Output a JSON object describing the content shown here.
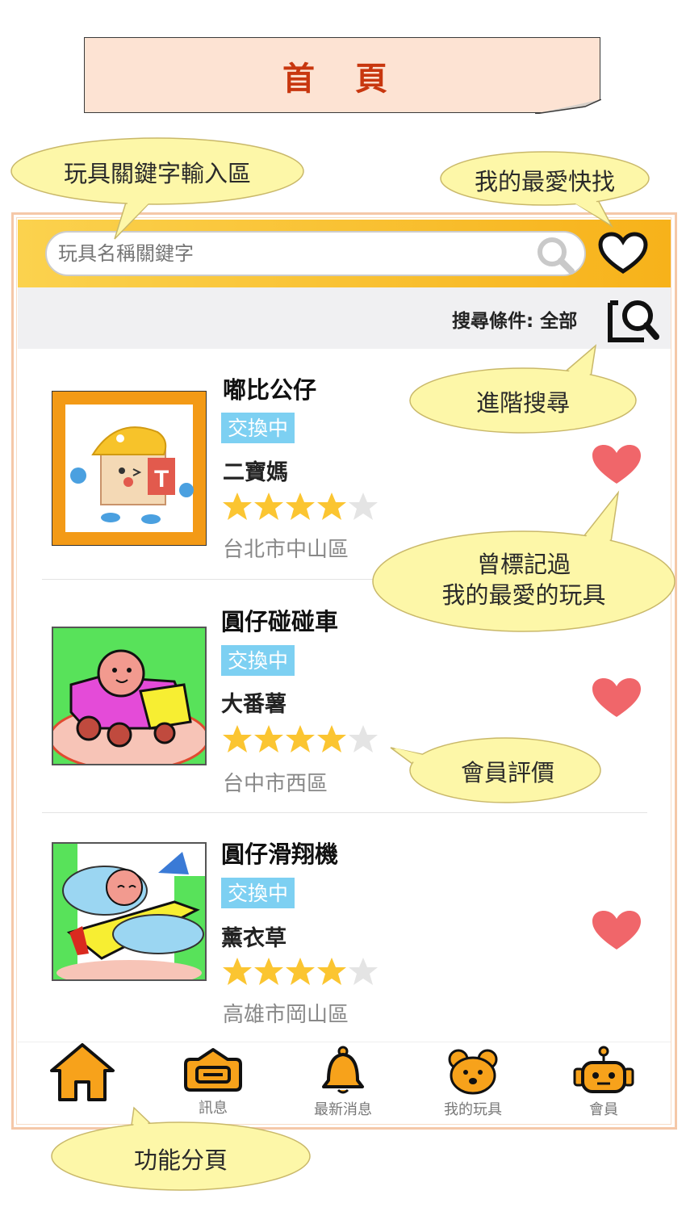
{
  "page_title": "首 頁",
  "search": {
    "placeholder": "玩具名稱關鍵字",
    "filter_label": "搜尋條件: 全部"
  },
  "items": [
    {
      "name": "嘟比公仔",
      "status": "交換中",
      "owner": "二寶媽",
      "rating": 4,
      "location": "台北市中山區",
      "favorited": true
    },
    {
      "name": "圓仔碰碰車",
      "status": "交換中",
      "owner": "大番薯",
      "rating": 4,
      "location": "台中市西區",
      "favorited": true
    },
    {
      "name": "圓仔滑翔機",
      "status": "交換中",
      "owner": "薰衣草",
      "rating": 4,
      "location": "高雄市岡山區",
      "favorited": true
    }
  ],
  "nav": [
    {
      "label": "",
      "icon": "home-icon"
    },
    {
      "label": "訊息",
      "icon": "message-icon"
    },
    {
      "label": "最新消息",
      "icon": "bell-icon"
    },
    {
      "label": "我的玩具",
      "icon": "bear-icon"
    },
    {
      "label": "會員",
      "icon": "robot-icon"
    }
  ],
  "callouts": {
    "keyword": "玩具關鍵字輸入區",
    "favorites": "我的最愛快找",
    "advanced": "進階搜尋",
    "marked_line1": "曾標記過",
    "marked_line2": "我的最愛的玩具",
    "rating": "會員評價",
    "tabs": "功能分頁"
  },
  "colors": {
    "accent": "#f7b21a",
    "badge": "#7dd0f2",
    "heart": "#f0666a",
    "star": "#fbc531",
    "callout": "#fdf7a8"
  }
}
